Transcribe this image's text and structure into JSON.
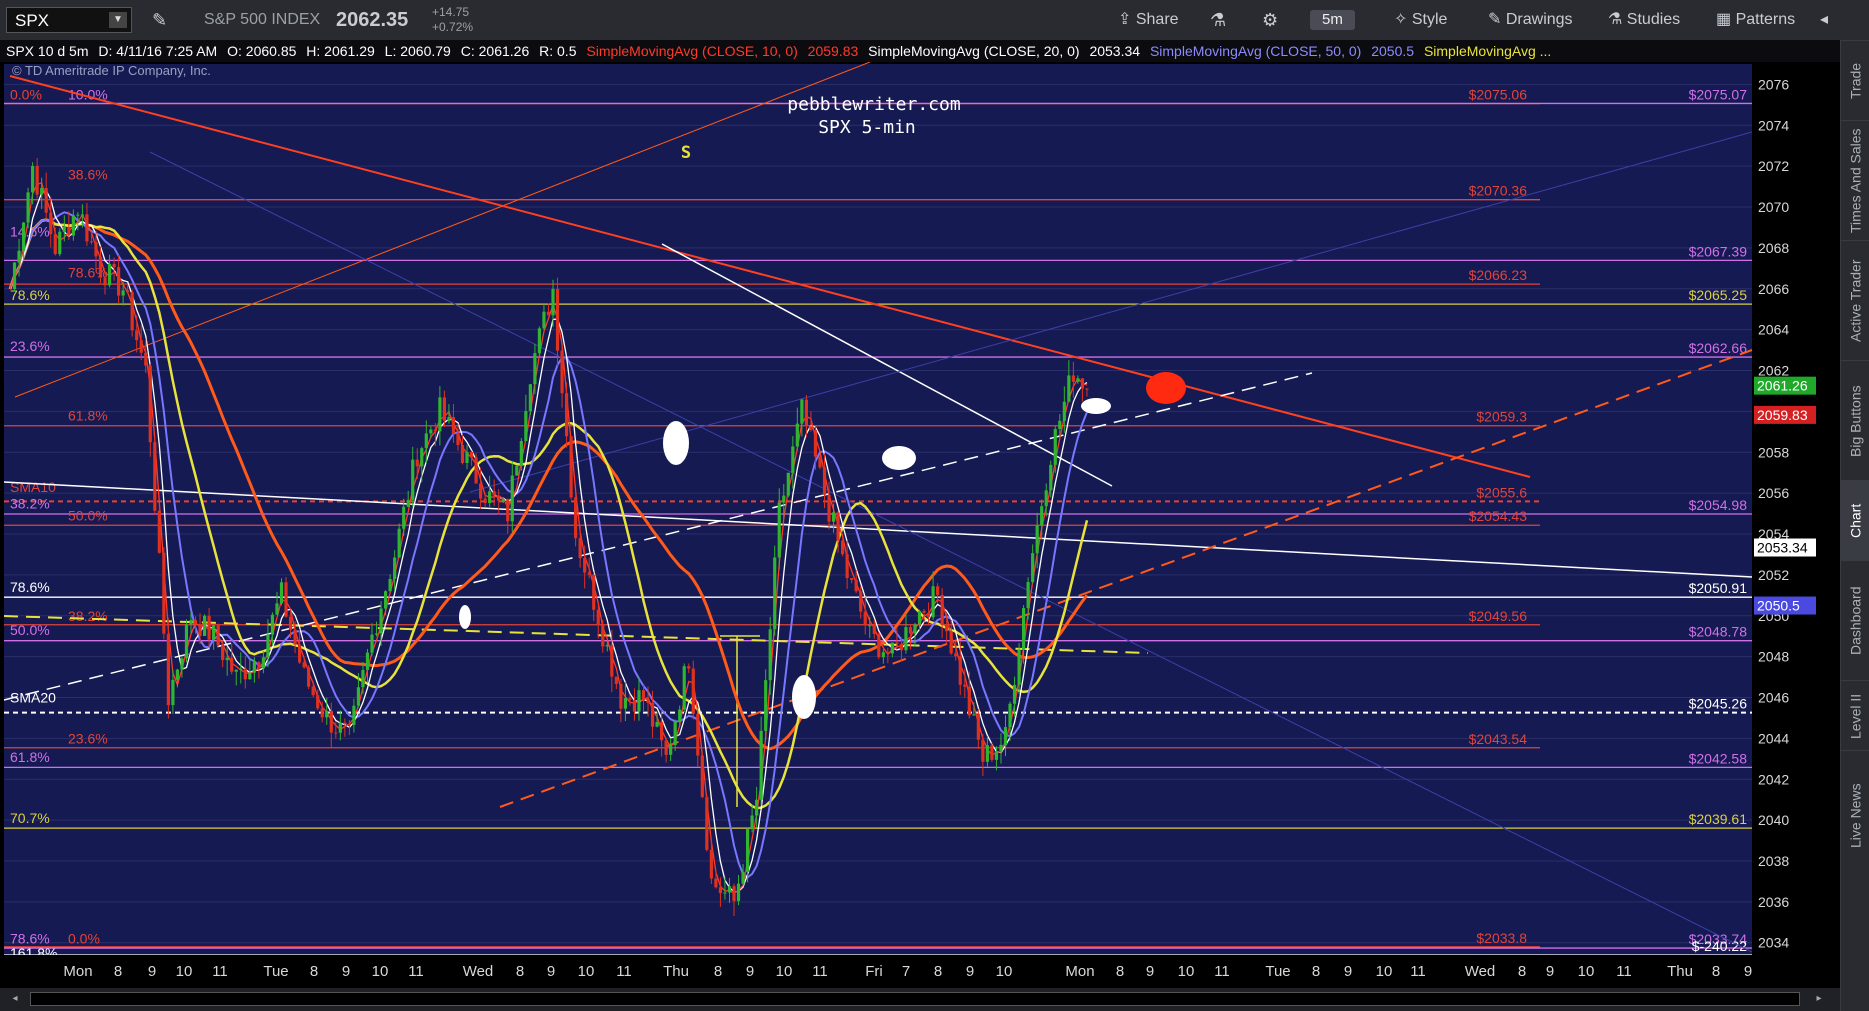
{
  "toolbar": {
    "symbol": "SPX",
    "name": "S&P 500 INDEX",
    "price": "2062.35",
    "change": "+14.75",
    "change_pct": "+0.72%",
    "share": "Share",
    "interval": "5m",
    "style": "Style",
    "drawings": "Drawings",
    "studies": "Studies",
    "patterns": "Patterns"
  },
  "info": {
    "desc": "SPX 10 d 5m",
    "date": "D: 4/11/16 7:25 AM",
    "open": "O: 2060.85",
    "high": "H: 2061.29",
    "low": "L: 2060.79",
    "close": "C: 2061.26",
    "range": "R: 0.5",
    "sma10": "SimpleMovingAvg (CLOSE, 10, 0)",
    "sma10_val": "2059.83",
    "sma20": "SimpleMovingAvg (CLOSE, 20, 0)",
    "sma20_val": "2053.34",
    "sma50": "SimpleMovingAvg (CLOSE, 50, 0)",
    "sma50_val": "2050.5",
    "sma_more": "SimpleMovingAvg ..."
  },
  "copyright": "© TD Ameritrade IP Company, Inc.",
  "watermark": [
    "pebblewriter.com",
    "SPX 5-min"
  ],
  "s_marker": "S",
  "sidebar": [
    "Trade",
    "Times And Sales",
    "Active Trader",
    "Big Buttons",
    "Chart",
    "Dashboard",
    "Level II",
    "Live News"
  ],
  "colors": {
    "bg": "#161a52",
    "candle_up": "#2fb52f",
    "candle_down": "#e0301e",
    "sma10": "#ff3a2a",
    "sma20": "#ffffff",
    "sma50": "#7777ff",
    "sma_yellow": "#e8e33a",
    "sma_orange": "#ff5a1a",
    "fib_red": "#e0443a",
    "fib_pink": "#d070e8",
    "fib_yellow": "#d8d040"
  },
  "chart_data": {
    "type": "candlestick",
    "y_ticks": [
      2034,
      2036,
      2038,
      2040,
      2042,
      2044,
      2046,
      2048,
      2050,
      2052,
      2054,
      2056,
      2058,
      2060,
      2062,
      2064,
      2066,
      2068,
      2070,
      2072,
      2074,
      2076
    ],
    "x_ticks": [
      "Mon",
      "8",
      "9",
      "10",
      "11",
      "Tue",
      "8",
      "9",
      "10",
      "11",
      "Wed",
      "8",
      "9",
      "10",
      "11",
      "Thu",
      "8",
      "9",
      "10",
      "11",
      "Fri",
      "7",
      "8",
      "9",
      "10",
      "Mon",
      "8",
      "9",
      "10",
      "11",
      "Tue",
      "8",
      "9",
      "10",
      "11",
      "Wed",
      "8",
      "9",
      "10",
      "11",
      "Thu",
      "8",
      "9"
    ],
    "ylim": [
      2033.4,
      2077.0
    ],
    "current_price": "2061.26",
    "badges": [
      {
        "value": "2061.26",
        "price": 2061.26,
        "color": "#1fa82a"
      },
      {
        "value": "2059.83",
        "price": 2059.83,
        "color": "#d42020"
      },
      {
        "value": "2053.34",
        "price": 2053.34,
        "color": "#ffffff"
      },
      {
        "value": "2050.5",
        "price": 2050.5,
        "color": "#4a4ae0"
      }
    ],
    "price_levels": [
      {
        "price": 2075.06,
        "label": "$2075.06",
        "color": "#e0443a",
        "pos": "mid"
      },
      {
        "price": 2075.07,
        "label": "$2075.07",
        "color": "#d070e8",
        "pos": "right"
      },
      {
        "price": 2070.36,
        "label": "$2070.36",
        "color": "#e0443a",
        "pos": "mid"
      },
      {
        "price": 2067.39,
        "label": "$2067.39",
        "color": "#d070e8",
        "pos": "right"
      },
      {
        "price": 2066.23,
        "label": "$2066.23",
        "color": "#e0443a",
        "pos": "mid"
      },
      {
        "price": 2065.25,
        "label": "$2065.25",
        "color": "#d8d040",
        "pos": "right"
      },
      {
        "price": 2062.66,
        "label": "$2062.66",
        "color": "#d070e8",
        "pos": "right"
      },
      {
        "price": 2059.3,
        "label": "$2059.3",
        "color": "#e0443a",
        "pos": "mid"
      },
      {
        "price": 2055.6,
        "label": "$2055.6",
        "color": "#e0443a",
        "pos": "mid"
      },
      {
        "price": 2054.98,
        "label": "$2054.98",
        "color": "#d070e8",
        "pos": "right"
      },
      {
        "price": 2054.43,
        "label": "$2054.43",
        "color": "#e0443a",
        "pos": "mid"
      },
      {
        "price": 2050.91,
        "label": "$2050.91",
        "color": "#ffffff",
        "pos": "right"
      },
      {
        "price": 2049.56,
        "label": "$2049.56",
        "color": "#e0443a",
        "pos": "mid"
      },
      {
        "price": 2048.78,
        "label": "$2048.78",
        "color": "#d070e8",
        "pos": "right"
      },
      {
        "price": 2045.26,
        "label": "$2045.26",
        "color": "#ffffff",
        "pos": "right"
      },
      {
        "price": 2043.54,
        "label": "$2043.54",
        "color": "#e0443a",
        "pos": "mid"
      },
      {
        "price": 2042.58,
        "label": "$2042.58",
        "color": "#d070e8",
        "pos": "right"
      },
      {
        "price": 2039.61,
        "label": "$2039.61",
        "color": "#d8d040",
        "pos": "right"
      },
      {
        "price": 2033.8,
        "label": "$2033.8",
        "color": "#e0443a",
        "pos": "mid"
      },
      {
        "price": 2033.74,
        "label": "$2033.74",
        "color": "#d070e8",
        "pos": "right"
      },
      {
        "price": 2033.4,
        "label": "$-240.22",
        "color": "#ffffff",
        "pos": "right"
      }
    ],
    "left_labels": [
      {
        "text": "0.0%",
        "price": 2075.3,
        "color": "#e0443a"
      },
      {
        "text": "10.0%",
        "price": 2075.3,
        "color": "#d070e8"
      },
      {
        "text": "38.6%",
        "price": 2071.4,
        "color": "#e0443a"
      },
      {
        "text": "14.6%",
        "price": 2068.6,
        "color": "#d070e8"
      },
      {
        "text": "78.6%",
        "price": 2066.6,
        "color": "#e0443a"
      },
      {
        "text": "78.6%",
        "price": 2065.5,
        "color": "#d8d040"
      },
      {
        "text": "23.6%",
        "price": 2063.0,
        "color": "#d070e8"
      },
      {
        "text": "61.8%",
        "price": 2059.6,
        "color": "#e0443a"
      },
      {
        "text": "SMA10",
        "price": 2056.1,
        "color": "#e0443a"
      },
      {
        "text": "38.2%",
        "price": 2055.3,
        "color": "#d070e8"
      },
      {
        "text": "50.0%",
        "price": 2054.7,
        "color": "#e0443a"
      },
      {
        "text": "78.6%",
        "price": 2051.2,
        "color": "#ffffff"
      },
      {
        "text": "38.2%",
        "price": 2049.8,
        "color": "#e0443a"
      },
      {
        "text": "50.0%",
        "price": 2049.1,
        "color": "#d070e8"
      },
      {
        "text": "SMA20",
        "price": 2045.8,
        "color": "#ffffff"
      },
      {
        "text": "23.6%",
        "price": 2043.8,
        "color": "#e0443a"
      },
      {
        "text": "61.8%",
        "price": 2042.9,
        "color": "#d070e8"
      },
      {
        "text": "70.7%",
        "price": 2039.9,
        "color": "#d8d040"
      },
      {
        "text": "78.6%",
        "price": 2034.0,
        "color": "#d070e8"
      },
      {
        "text": "0.0%",
        "price": 2034.0,
        "color": "#e0443a"
      },
      {
        "text": "161.8%",
        "price": 2033.3,
        "color": "#ffffff"
      }
    ],
    "close_path": [
      [
        0,
        2066
      ],
      [
        5,
        2072
      ],
      [
        10,
        2068
      ],
      [
        15,
        2070
      ],
      [
        20,
        2067
      ],
      [
        25,
        2066
      ],
      [
        30,
        2062
      ],
      [
        35,
        2046
      ],
      [
        40,
        2050
      ],
      [
        45,
        2049
      ],
      [
        50,
        2047
      ],
      [
        55,
        2048
      ],
      [
        60,
        2051
      ],
      [
        65,
        2047
      ],
      [
        70,
        2045
      ],
      [
        75,
        2044
      ],
      [
        80,
        2049
      ],
      [
        85,
        2053
      ],
      [
        90,
        2058
      ],
      [
        95,
        2060
      ],
      [
        100,
        2058
      ],
      [
        105,
        2056
      ],
      [
        110,
        2055
      ],
      [
        115,
        2062
      ],
      [
        120,
        2066
      ],
      [
        125,
        2054
      ],
      [
        130,
        2050
      ],
      [
        135,
        2046
      ],
      [
        140,
        2046
      ],
      [
        145,
        2043
      ],
      [
        150,
        2048
      ],
      [
        155,
        2037
      ],
      [
        160,
        2036
      ],
      [
        165,
        2041
      ],
      [
        170,
        2055
      ],
      [
        175,
        2060
      ],
      [
        180,
        2056
      ],
      [
        185,
        2052
      ],
      [
        190,
        2049
      ],
      [
        195,
        2048
      ],
      [
        200,
        2050
      ],
      [
        205,
        2051
      ],
      [
        210,
        2047
      ],
      [
        215,
        2043
      ],
      [
        220,
        2044
      ],
      [
        225,
        2052
      ],
      [
        230,
        2058
      ],
      [
        235,
        2062
      ],
      [
        238,
        2061.26
      ]
    ]
  }
}
